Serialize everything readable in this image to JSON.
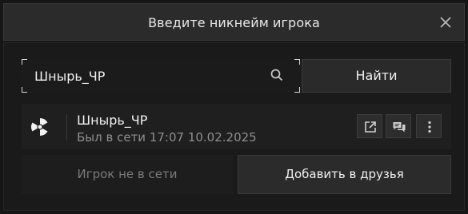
{
  "dialog": {
    "title": "Введите никнейм игрока"
  },
  "search": {
    "value": "Шнырь_ЧР",
    "find_label": "Найти"
  },
  "player": {
    "nickname": "Шнырь_ЧР",
    "status": "Был в сети 17:07 10.02.2025"
  },
  "actions": {
    "offline_label": "Игрок не в сети",
    "add_friend_label": "Добавить в друзья"
  },
  "icons": {
    "close": "close-icon",
    "search": "search-icon",
    "avatar": "radiation-icon",
    "open_profile": "external-link-icon",
    "chat": "chat-icon",
    "more": "more-vertical-icon"
  },
  "colors": {
    "background": "#161616",
    "header": "#2b2b2b",
    "button": "#2b2b2b",
    "muted_text": "#8e8e8e"
  }
}
